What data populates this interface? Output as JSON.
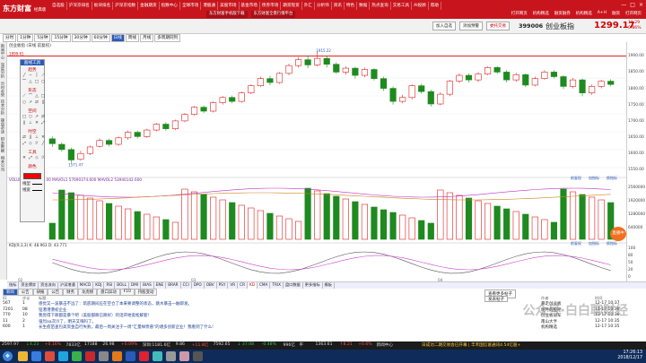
{
  "app": {
    "logo": "东方财富",
    "logo_sub": "经典版",
    "menus": [
      "自选股",
      "沪深京排名",
      "板块排名",
      "沪深京指数",
      "金融期货",
      "指数中心",
      "全球市场",
      "港股通",
      "美股市场",
      "基金市场",
      "债券市场",
      "期货现货",
      "外汇",
      "分析师",
      "资讯",
      "特色",
      "数据",
      "热点查询",
      "交易工具",
      "AI投顾",
      "帮助"
    ],
    "site_links": [
      "东方财富手机版下载",
      "东方财富全景行情平台"
    ],
    "right_menus": [
      "打开网页",
      "机构精选",
      "融资融券",
      "机构精选",
      "A+H",
      "融资",
      "打开网页"
    ],
    "window_controls": [
      "—",
      "□",
      "×"
    ]
  },
  "toolbar": {
    "add_watch": "加入自选",
    "add_plate": "添加预警",
    "more": "委托交易",
    "stock_code": "399006",
    "stock_name": "创业板指",
    "price": "1299.17",
    "change_pct": "11.29",
    "change_pct2": "0.86%"
  },
  "periods": {
    "items": [
      "分时",
      "1分钟",
      "5分钟",
      "15分钟",
      "30分钟",
      "60分钟",
      "日线",
      "周线",
      "月线",
      "多周期同列"
    ],
    "active_index": 6
  },
  "left_rail": [
    "新闻中心",
    "深度分析",
    "分时走势",
    "技术分析",
    "操盘必读",
    "财务数据",
    "相关公司"
  ],
  "chart": {
    "title": "创业板指 (日线 前复权)",
    "high_label": "1899.61",
    "peak_label": "1915.22",
    "low_label": "1571.47",
    "y_ticks": [
      "1900.00",
      "1850.00",
      "1800.00",
      "1750.00",
      "1700.00",
      "1650.00",
      "1600.00",
      "1550.00"
    ],
    "indicator_y_ticks": [
      "2560000",
      "1920000",
      "1280000",
      "640000"
    ],
    "kdj_y_ticks": [
      "100",
      "80",
      "50",
      "20",
      "0"
    ],
    "x_ticks": [
      "02",
      "03",
      "04"
    ],
    "vol_legend": "VOLUME 63541325.00  MAVOL1 57690374.600  MAVOL2 53940142.600",
    "kdj_legend": "KDJ(9,3,3)  K: 48.963  D: 43.771",
    "zoom_buttons": [
      "前复权",
      "加指标",
      "换指标"
    ],
    "candles": [
      {
        "o": 1645,
        "c": 1630,
        "h": 1652,
        "l": 1620
      },
      {
        "o": 1628,
        "c": 1612,
        "h": 1634,
        "l": 1606
      },
      {
        "o": 1612,
        "c": 1580,
        "h": 1618,
        "l": 1571
      },
      {
        "o": 1582,
        "c": 1600,
        "h": 1608,
        "l": 1578
      },
      {
        "o": 1600,
        "c": 1620,
        "h": 1624,
        "l": 1595
      },
      {
        "o": 1622,
        "c": 1640,
        "h": 1646,
        "l": 1618
      },
      {
        "o": 1640,
        "c": 1628,
        "h": 1645,
        "l": 1622
      },
      {
        "o": 1628,
        "c": 1648,
        "h": 1652,
        "l": 1624
      },
      {
        "o": 1648,
        "c": 1665,
        "h": 1670,
        "l": 1642
      },
      {
        "o": 1665,
        "c": 1652,
        "h": 1670,
        "l": 1646
      },
      {
        "o": 1652,
        "c": 1672,
        "h": 1676,
        "l": 1648
      },
      {
        "o": 1672,
        "c": 1690,
        "h": 1694,
        "l": 1668
      },
      {
        "o": 1690,
        "c": 1676,
        "h": 1696,
        "l": 1670
      },
      {
        "o": 1676,
        "c": 1700,
        "h": 1704,
        "l": 1672
      },
      {
        "o": 1700,
        "c": 1720,
        "h": 1724,
        "l": 1696
      },
      {
        "o": 1720,
        "c": 1742,
        "h": 1746,
        "l": 1716
      },
      {
        "o": 1742,
        "c": 1730,
        "h": 1748,
        "l": 1724
      },
      {
        "o": 1730,
        "c": 1756,
        "h": 1760,
        "l": 1726
      },
      {
        "o": 1756,
        "c": 1772,
        "h": 1776,
        "l": 1750
      },
      {
        "o": 1772,
        "c": 1760,
        "h": 1778,
        "l": 1754
      },
      {
        "o": 1760,
        "c": 1786,
        "h": 1790,
        "l": 1756
      },
      {
        "o": 1786,
        "c": 1808,
        "h": 1812,
        "l": 1782
      },
      {
        "o": 1808,
        "c": 1830,
        "h": 1836,
        "l": 1804
      },
      {
        "o": 1830,
        "c": 1818,
        "h": 1838,
        "l": 1810
      },
      {
        "o": 1818,
        "c": 1846,
        "h": 1850,
        "l": 1814
      },
      {
        "o": 1846,
        "c": 1870,
        "h": 1876,
        "l": 1840
      },
      {
        "o": 1870,
        "c": 1888,
        "h": 1896,
        "l": 1864
      },
      {
        "o": 1888,
        "c": 1872,
        "h": 1900,
        "l": 1862
      },
      {
        "o": 1872,
        "c": 1892,
        "h": 1915,
        "l": 1868
      },
      {
        "o": 1892,
        "c": 1874,
        "h": 1898,
        "l": 1864
      },
      {
        "o": 1874,
        "c": 1850,
        "h": 1880,
        "l": 1844
      },
      {
        "o": 1850,
        "c": 1862,
        "h": 1868,
        "l": 1842
      },
      {
        "o": 1862,
        "c": 1840,
        "h": 1866,
        "l": 1830
      },
      {
        "o": 1840,
        "c": 1858,
        "h": 1864,
        "l": 1834
      },
      {
        "o": 1858,
        "c": 1830,
        "h": 1862,
        "l": 1824
      },
      {
        "o": 1830,
        "c": 1800,
        "h": 1836,
        "l": 1792
      },
      {
        "o": 1800,
        "c": 1760,
        "h": 1806,
        "l": 1750
      },
      {
        "o": 1760,
        "c": 1772,
        "h": 1780,
        "l": 1754
      },
      {
        "o": 1772,
        "c": 1808,
        "h": 1812,
        "l": 1766
      },
      {
        "o": 1808,
        "c": 1790,
        "h": 1814,
        "l": 1784
      },
      {
        "o": 1790,
        "c": 1752,
        "h": 1796,
        "l": 1744
      },
      {
        "o": 1752,
        "c": 1782,
        "h": 1788,
        "l": 1748
      },
      {
        "o": 1782,
        "c": 1822,
        "h": 1826,
        "l": 1776
      },
      {
        "o": 1822,
        "c": 1840,
        "h": 1846,
        "l": 1816
      },
      {
        "o": 1840,
        "c": 1826,
        "h": 1846,
        "l": 1818
      },
      {
        "o": 1826,
        "c": 1844,
        "h": 1850,
        "l": 1820
      },
      {
        "o": 1844,
        "c": 1864,
        "h": 1868,
        "l": 1840
      },
      {
        "o": 1864,
        "c": 1850,
        "h": 1868,
        "l": 1844
      },
      {
        "o": 1850,
        "c": 1826,
        "h": 1856,
        "l": 1818
      },
      {
        "o": 1826,
        "c": 1842,
        "h": 1848,
        "l": 1820
      },
      {
        "o": 1842,
        "c": 1810,
        "h": 1846,
        "l": 1804
      },
      {
        "o": 1810,
        "c": 1830,
        "h": 1836,
        "l": 1806
      },
      {
        "o": 1830,
        "c": 1850,
        "h": 1856,
        "l": 1826
      },
      {
        "o": 1850,
        "c": 1836,
        "h": 1856,
        "l": 1830
      },
      {
        "o": 1836,
        "c": 1806,
        "h": 1840,
        "l": 1798
      },
      {
        "o": 1806,
        "c": 1826,
        "h": 1832,
        "l": 1800
      },
      {
        "o": 1826,
        "c": 1786,
        "h": 1830,
        "l": 1776
      },
      {
        "o": 1786,
        "c": 1806,
        "h": 1812,
        "l": 1780
      },
      {
        "o": 1806,
        "c": 1822,
        "h": 1826,
        "l": 1800
      },
      {
        "o": 1822,
        "c": 1812,
        "h": 1828,
        "l": 1806
      }
    ]
  },
  "tool_panel": {
    "title": "画线工具",
    "sections": [
      "趋势",
      "形态",
      "空间",
      "时空",
      "工具",
      "颜色"
    ],
    "style_labels": [
      "线型",
      "线宽"
    ]
  },
  "indicator_tabs": {
    "items": [
      "指标",
      "资金博弈",
      "资金流向",
      "沪深港通",
      "MACD",
      "KDJ",
      "RSI",
      "BOLL",
      "DMI",
      "BIAS",
      "ENE",
      "BRAR",
      "CCI",
      "DPO",
      "OBV",
      "PSY",
      "VR",
      "CR",
      "KD",
      "CMA",
      "TRIX",
      "盘口数据",
      "更多指标",
      "模板"
    ],
    "active_index": 18
  },
  "news": {
    "tabs": [
      "新闻",
      "公告",
      "研报",
      "公告",
      "财务",
      "龙虎榜",
      "盘口异动",
      "F10",
      "持股变动"
    ],
    "active_index": 0,
    "buttons": [
      "查看更多帖子",
      "发表帖子"
    ],
    "head": [
      "ID",
      "评论",
      "标题",
      "作者",
      "时间"
    ],
    "rows": [
      {
        "id": "567",
        "cmt": "1",
        "title": "感觉又一波暴击不远了：筑底期间应在空仓了本来要调整的状态，跳水暴击一触即发。",
        "author": "暴走创业板",
        "time": "12-17 10:37"
      },
      {
        "id": "7201",
        "cmt": "08",
        "title": "钮港港港初企业",
        "author": "明月的股吧",
        "time": "12-17 10:36"
      },
      {
        "id": "770",
        "cmt": "10",
        "title": "我觉得下跌都是暴个吧（美股都跌已跌好）的话开始宽松解套!",
        "author": "创业板冠军",
        "time": "12-17 10:36"
      },
      {
        "id": "11",
        "cmt": "2",
        "title": "强烈aa次冷了，明天又嗨吗了。",
        "author": "南山大亨",
        "time": "12-17 10:35"
      },
      {
        "id": "600",
        "cmt": "1",
        "title": "长生疫苗查包高资金自行失败，最后一周关注于一周\"汇量样债悬\"的诸多创新企业！我看到了什么!",
        "author": "机构精选",
        "time": "12-17 10:35"
      }
    ]
  },
  "status_bar": {
    "items": [
      "2597.97",
      "↓4.23",
      "+0.16%",
      "7833亿",
      "17188",
      "26.98",
      "+0.09%",
      "深圳:1181.6亿",
      "9.86",
      "+11.8亿",
      "7592.65",
      "↓ 37.08",
      "-0.48%",
      "996亿",
      "平",
      "1363.61",
      "↑8.21",
      "+0.6%",
      "新闻中心"
    ],
    "ticker": "日成功二期交易会已开幕 | 丰禾国信富通讯4.54亿股+"
  },
  "taskbar": {
    "time": "17:26:13",
    "date": "2018/12/17"
  },
  "watermark": "公众号·白白聊财经",
  "live_label": "直播中"
}
